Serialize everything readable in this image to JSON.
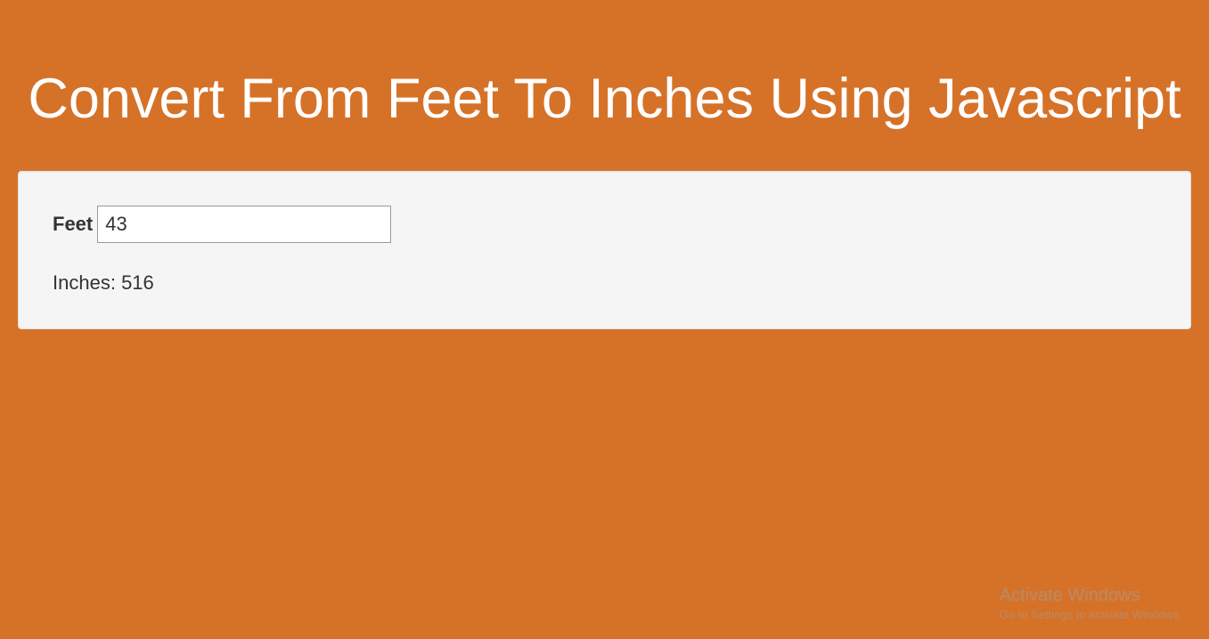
{
  "title": "Convert From Feet To Inches Using Javascript",
  "form": {
    "label": "Feet",
    "input_value": "43",
    "result_label": "Inches:",
    "result_value": "516"
  },
  "watermark": {
    "title": "Activate Windows",
    "subtitle": "Go to Settings to activate Windows."
  }
}
